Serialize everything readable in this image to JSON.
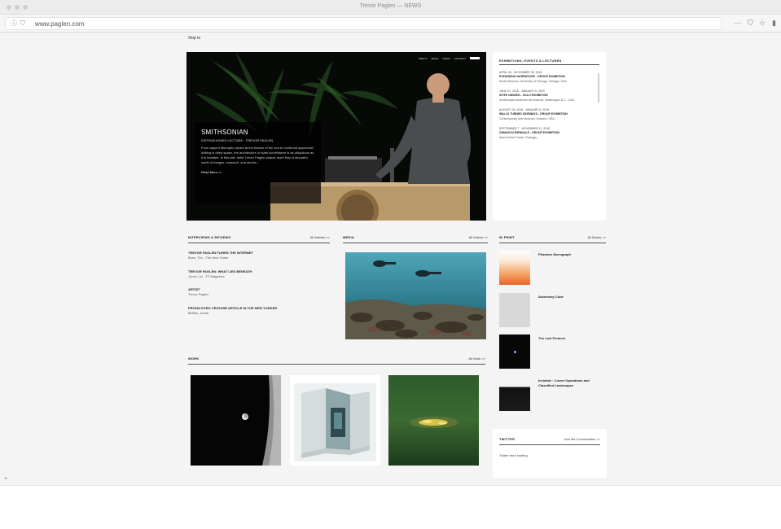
{
  "browser": {
    "window_title": "Trevor Paglen — NEWS",
    "url": "www.paglen.com",
    "more_icon": "⋯",
    "pocket_icon": "pocket-icon",
    "bookmark_icon": "star-icon"
  },
  "page": {
    "skip_link": "Skip to"
  },
  "hero": {
    "nav": [
      "ABOUT",
      "NEWS",
      "WORK",
      "CONTACT"
    ],
    "title": "SMITHSONIAN",
    "subtitle": "DISTINGUISHED LECTURE - TREVOR PAGLEN",
    "text": "From tapped fiberoptic cables at the bottom of the sea to moribund spacecraft drifting in deep space, the architecture of state surveillance is as ubiquitous as it is invisible. In this talk, artist Trevor Paglen shares more than a decade's worth of images, research, and stories...",
    "more": "Read More >>"
  },
  "events": {
    "heading": "EXHIBITIONS, EVENTS & LECTURES",
    "items": [
      {
        "date": "APRIL 26 - DECEMBER 30, 2018",
        "title": "EXPANDING NARRATIVES - GROUP EXHIBITION",
        "place": "Smart Museum, University of Chicago, Chicago, USA"
      },
      {
        "date": "JUNE 21, 2018 - JANUARY 6, 2019",
        "title": "SITES UNSEEN - SOLO EXHIBITION",
        "place": "Smithsonian American Art Museum, Washington D.C., USA"
      },
      {
        "date": "AUGUST 26, 2018 - JANUARY 6, 2019",
        "title": "WALLS TURNED SIDEWAYS - GROUP EXHIBITION",
        "place": "Contemporary Arts Museum, Houston, USA"
      },
      {
        "date": "SEPTEMBER 7 - NOVEMBER 11, 2018",
        "title": "GWANGJU BIENNALE - GROUP EXHIBITION",
        "place": "Asia Culture Center, Gwangju..."
      }
    ]
  },
  "interviews": {
    "heading": "INTERVIEWS & REVIEWS",
    "link": "All Articles >>",
    "items": [
      {
        "title": "TREVOR PAGLEN FLIRRS THE INTERNET",
        "by": "Bons, Tim - The New Yorker"
      },
      {
        "title": "TREVOR PAGLEN: WHAT LIES BENEATH",
        "by": "Jones, Liz - FT Magazine"
      },
      {
        "title": "ARTIST",
        "by": "Trevor Paglen"
      },
      {
        "title": "PRYING EYES: FEATURE ARTICLE IN THE NEW YORKER",
        "by": "Bellian, Jonah"
      }
    ]
  },
  "media": {
    "heading": "MEDIA",
    "link": "All Videos >>"
  },
  "in_print": {
    "heading": "IN PRINT",
    "link": "All Books >>",
    "items": [
      {
        "title": "Phantom Monograph"
      },
      {
        "title": "Autonomy Cube"
      },
      {
        "title": "The Last Pictures"
      },
      {
        "title": "Invisible : Covert Operations and Classified Landscapes"
      }
    ]
  },
  "work": {
    "heading": "WORK",
    "link": "All Work >>"
  },
  "twitter": {
    "heading": "TWITTER",
    "link": "Join the Conversation >>",
    "status": "Twitter feed loading"
  },
  "colors": {
    "page_bg": "#f4f4f4",
    "card_bg": "#ffffff",
    "hero_bg": "#070a07",
    "text_dark": "#222222"
  }
}
